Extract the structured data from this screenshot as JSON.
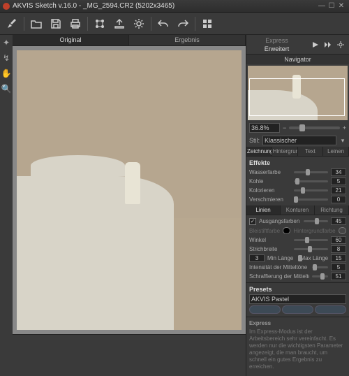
{
  "titlebar": {
    "title": "AKVIS Sketch v.16.0 - _MG_2594.CR2 (5202x3465)"
  },
  "tabs": {
    "original": "Original",
    "result": "Ergebnis"
  },
  "mode": {
    "express": "Express",
    "advanced": "Erweitert"
  },
  "navigator": {
    "title": "Navigator",
    "zoom": "36.8%"
  },
  "style": {
    "label": "Stil:",
    "value": "Klassischer"
  },
  "paramTabs": {
    "drawing": "Zeichnung",
    "background": "Hintergrund",
    "text": "Text",
    "canvas": "Leinen"
  },
  "effects": {
    "header": "Effekte",
    "watercolor": {
      "label": "Wasserfarbe",
      "value": 34
    },
    "charcoal": {
      "label": "Kohle",
      "value": 5
    },
    "coloration": {
      "label": "Kolorieren",
      "value": 21
    },
    "smudge": {
      "label": "Verschmieren",
      "value": 0
    }
  },
  "strokeTabs": {
    "lines": "Linien",
    "contours": "Konturen",
    "direction": "Richtung"
  },
  "strokes": {
    "originalColors": {
      "label": "Ausgangsfarben",
      "value": 45,
      "checked": true
    },
    "pencilColor": "Bleistiftfarbe",
    "bgColor": "Hintergrundfarbe",
    "angle": {
      "label": "Winkel",
      "value": 60
    },
    "strokeWidth": {
      "label": "Strichbreite",
      "value": 8
    },
    "minLen": {
      "label": "Min Länge",
      "value": 3
    },
    "maxLen": {
      "label": "Max Länge",
      "value": 15
    },
    "midIntensity": {
      "label": "Intensität der Mitteltöne",
      "value": 5
    },
    "midHatching": {
      "label": "Schraffierung der Mitteltöne",
      "value": 51
    }
  },
  "presets": {
    "header": "Presets",
    "value": "AKVIS Pastel"
  },
  "info": {
    "header": "Express",
    "text": "Im Express-Modus ist der Arbeitsbereich sehr vereinfacht. Es werden nur die wichtigsten Parameter angezeigt, die man braucht, um schnell ein gutes Ergebnis zu erreichen."
  }
}
